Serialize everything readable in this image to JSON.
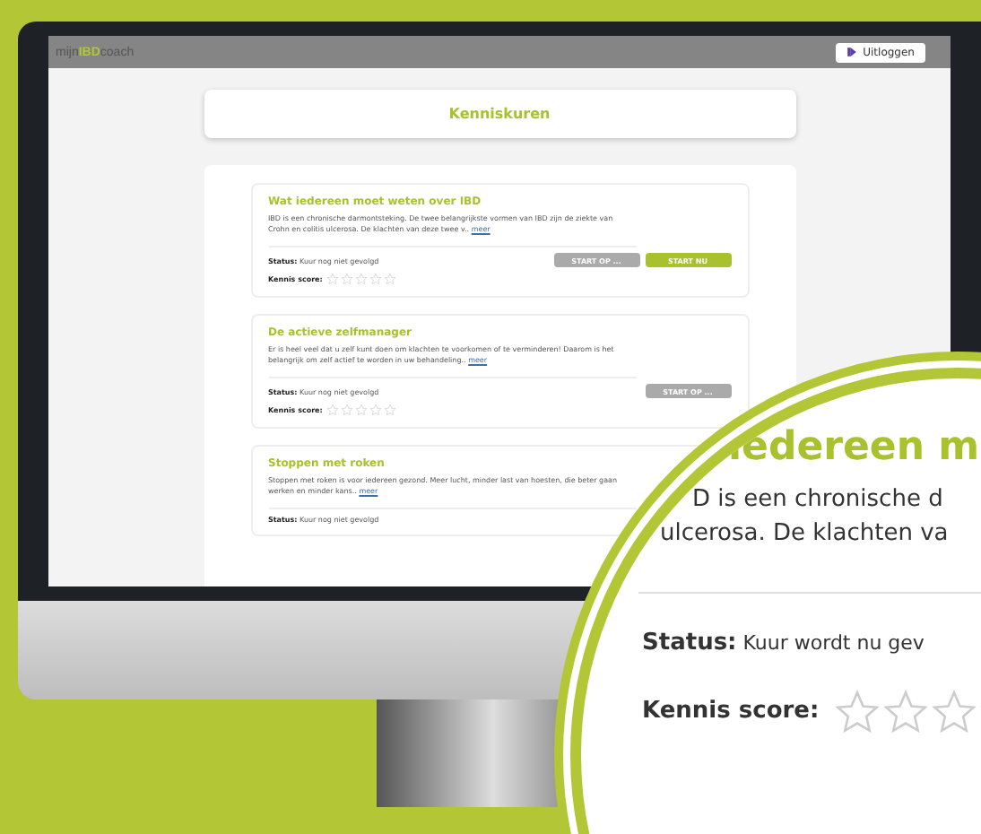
{
  "header": {
    "logo": {
      "prefix": "mijn",
      "highlight": "IBD",
      "suffix": "coach"
    },
    "logout": "Uitloggen"
  },
  "page_title": "Kenniskuren",
  "courses": [
    {
      "title": "Wat iedereen moet weten over IBD",
      "description": "IBD is een chronische darmontsteking. De twee belangrijkste vormen van IBD zijn de ziekte van Crohn en colitis ulcerosa. De klachten van deze twee v..",
      "more": "meer",
      "status_label": "Status:",
      "status": "Kuur nog niet gevolgd",
      "score_label": "Kennis score:",
      "stars": 0,
      "buttons": [
        {
          "label": "START OP ...",
          "kind": "secondary"
        },
        {
          "label": "START NU",
          "kind": "primary"
        }
      ]
    },
    {
      "title": "De actieve zelfmanager",
      "description": "Er is heel veel dat u zelf kunt doen om klachten te voorkomen of te verminderen! Daarom is het belangrijk om zelf actief te worden in uw behandeling..",
      "more": "meer",
      "status_label": "Status:",
      "status": "Kuur nog niet gevolgd",
      "score_label": "Kennis score:",
      "stars": 0,
      "buttons": [
        {
          "label": "START OP ...",
          "kind": "secondary"
        }
      ]
    },
    {
      "title": "Stoppen met roken",
      "description": "Stoppen met roken is voor iedereen gezond. Meer lucht, minder last van hoesten, die beter gaan werken en minder kans..",
      "more": "meer",
      "status_label": "Status:",
      "status": "Kuur nog niet gevolgd"
    }
  ],
  "magnifier": {
    "title": "iedereen m",
    "lines": [
      "D is een chronische d",
      "ulcerosa. De klachten va"
    ],
    "status_label": "Status:",
    "status": "Kuur wordt nu gev",
    "score_label": "Kennis score:",
    "stars": 0
  }
}
